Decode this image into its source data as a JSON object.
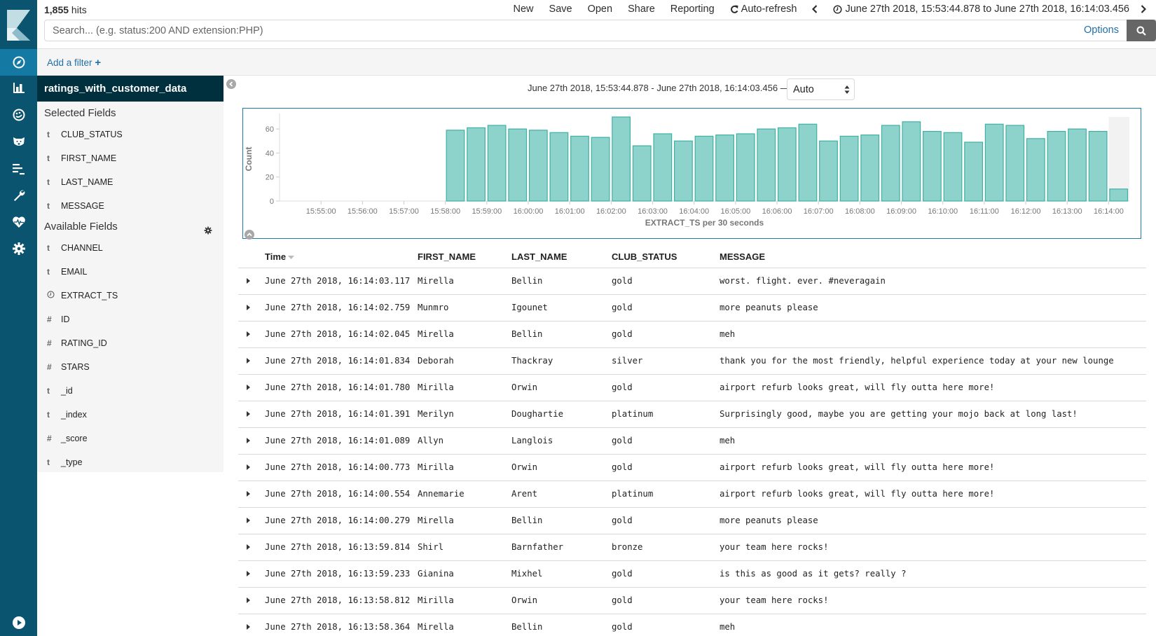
{
  "app": {
    "nav_items": [
      {
        "name": "discover",
        "icon": "compass-icon",
        "active": true
      },
      {
        "name": "visualize",
        "icon": "bar-chart-icon"
      },
      {
        "name": "dashboard",
        "icon": "dashboard-gauge-icon"
      },
      {
        "name": "timelion",
        "icon": "timelion-bear-icon"
      },
      {
        "name": "apm",
        "icon": "apm-lines-icon"
      },
      {
        "name": "dev-tools",
        "icon": "wrench-icon"
      },
      {
        "name": "monitoring",
        "icon": "heartbeat-icon"
      },
      {
        "name": "management",
        "icon": "gear-icon"
      }
    ],
    "collapse_nav_icon": "play-circle-icon"
  },
  "topbar": {
    "hits_count": "1,855",
    "hits_label": " hits",
    "menu": {
      "new": "New",
      "save": "Save",
      "open": "Open",
      "share": "Share",
      "reporting": "Reporting",
      "auto_refresh": "Auto-refresh",
      "time_range": "June 27th 2018, 15:53:44.878 to June 27th 2018, 16:14:03.456"
    },
    "search": {
      "value": "",
      "placeholder": "Search... (e.g. status:200 AND extension:PHP)"
    },
    "options_label": "Options"
  },
  "filterbar": {
    "add_filter_label": "Add a filter",
    "add_filter_plus": "+"
  },
  "sidebar": {
    "index_pattern": "ratings_with_customer_data",
    "selected_title": "Selected Fields",
    "selected_fields": [
      {
        "type": "t",
        "name": "CLUB_STATUS"
      },
      {
        "type": "t",
        "name": "FIRST_NAME"
      },
      {
        "type": "t",
        "name": "LAST_NAME"
      },
      {
        "type": "t",
        "name": "MESSAGE"
      }
    ],
    "available_title": "Available Fields",
    "available_fields": [
      {
        "type": "t",
        "name": "CHANNEL"
      },
      {
        "type": "t",
        "name": "EMAIL"
      },
      {
        "type": "date",
        "name": "EXTRACT_TS"
      },
      {
        "type": "#",
        "name": "ID"
      },
      {
        "type": "#",
        "name": "RATING_ID"
      },
      {
        "type": "#",
        "name": "STARS"
      },
      {
        "type": "t",
        "name": "_id"
      },
      {
        "type": "t",
        "name": "_index"
      },
      {
        "type": "#",
        "name": "_score"
      },
      {
        "type": "t",
        "name": "_type"
      }
    ]
  },
  "histogram_header": {
    "range_text": "June 27th 2018, 15:53:44.878 - June 27th 2018, 16:14:03.456 —",
    "interval_selected": "Auto"
  },
  "chart_data": {
    "type": "bar",
    "title": "",
    "xlabel": "EXTRACT_TS per 30 seconds",
    "ylabel": "Count",
    "ylim": [
      0,
      70
    ],
    "yticks": [
      0,
      20,
      40,
      60
    ],
    "xticks": [
      "15:55:00",
      "15:56:00",
      "15:57:00",
      "15:58:00",
      "15:59:00",
      "16:00:00",
      "16:01:00",
      "16:02:00",
      "16:03:00",
      "16:04:00",
      "16:05:00",
      "16:06:00",
      "16:07:00",
      "16:08:00",
      "16:09:00",
      "16:10:00",
      "16:11:00",
      "16:12:00",
      "16:13:00",
      "16:14:00"
    ],
    "x_range": [
      "15:54:00",
      "16:14:30"
    ],
    "interval_seconds": 30,
    "categories": [
      "15:58:00",
      "15:58:30",
      "15:59:00",
      "15:59:30",
      "16:00:00",
      "16:00:30",
      "16:01:00",
      "16:01:30",
      "16:02:00",
      "16:02:30",
      "16:03:00",
      "16:03:30",
      "16:04:00",
      "16:04:30",
      "16:05:00",
      "16:05:30",
      "16:06:00",
      "16:06:30",
      "16:07:00",
      "16:07:30",
      "16:08:00",
      "16:08:30",
      "16:09:00",
      "16:09:30",
      "16:10:00",
      "16:10:30",
      "16:11:00",
      "16:11:30",
      "16:12:00",
      "16:12:30",
      "16:13:00",
      "16:13:30",
      "16:14:00"
    ],
    "values": [
      59,
      61,
      63,
      60,
      59,
      57,
      54,
      53,
      70,
      46,
      56,
      50,
      54,
      55,
      56,
      60,
      61,
      64,
      50,
      54,
      55,
      63,
      66,
      58,
      57,
      49,
      64,
      63,
      52,
      58,
      60,
      58,
      10
    ],
    "partial_last_bucket": true,
    "bar_color": "#8dd3cb",
    "bar_stroke": "#3fb0a3",
    "grid": false,
    "legend": "none"
  },
  "table": {
    "columns": [
      "Time",
      "FIRST_NAME",
      "LAST_NAME",
      "CLUB_STATUS",
      "MESSAGE"
    ],
    "sort_column": "Time",
    "sort_direction": "desc",
    "rows": [
      [
        "June 27th 2018, 16:14:03.117",
        "Mirella",
        "Bellin",
        "gold",
        "worst. flight. ever. #neveragain"
      ],
      [
        "June 27th 2018, 16:14:02.759",
        "Munmro",
        "Igounet",
        "gold",
        "more peanuts please"
      ],
      [
        "June 27th 2018, 16:14:02.045",
        "Mirella",
        "Bellin",
        "gold",
        "meh"
      ],
      [
        "June 27th 2018, 16:14:01.834",
        "Deborah",
        "Thackray",
        "silver",
        "thank you for the most friendly, helpful experience today at your new lounge"
      ],
      [
        "June 27th 2018, 16:14:01.780",
        "Mirilla",
        "Orwin",
        "gold",
        "airport refurb looks great, will fly outta here more!"
      ],
      [
        "June 27th 2018, 16:14:01.391",
        "Merilyn",
        "Doughartie",
        "platinum",
        "Surprisingly good, maybe you are getting your mojo back at long last!"
      ],
      [
        "June 27th 2018, 16:14:01.089",
        "Allyn",
        "Langlois",
        "gold",
        "meh"
      ],
      [
        "June 27th 2018, 16:14:00.773",
        "Mirilla",
        "Orwin",
        "gold",
        "airport refurb looks great, will fly outta here more!"
      ],
      [
        "June 27th 2018, 16:14:00.554",
        "Annemarie",
        "Arent",
        "platinum",
        "airport refurb looks great, will fly outta here more!"
      ],
      [
        "June 27th 2018, 16:14:00.279",
        "Mirella",
        "Bellin",
        "gold",
        "more peanuts please"
      ],
      [
        "June 27th 2018, 16:13:59.814",
        "Shirl",
        "Barnfather",
        "bronze",
        "your team here rocks!"
      ],
      [
        "June 27th 2018, 16:13:59.233",
        "Gianina",
        "Mixhel",
        "gold",
        "is this as good as it gets? really ?"
      ],
      [
        "June 27th 2018, 16:13:58.812",
        "Mirilla",
        "Orwin",
        "gold",
        "your team here rocks!"
      ],
      [
        "June 27th 2018, 16:13:58.364",
        "Mirella",
        "Bellin",
        "gold",
        "meh"
      ]
    ]
  },
  "colors": {
    "nav_bg": "#0b5470",
    "nav_active": "#147aa3",
    "index_header_bg": "#00303e",
    "link": "#1f6fa8",
    "chart_border": "#1f7ba6"
  }
}
